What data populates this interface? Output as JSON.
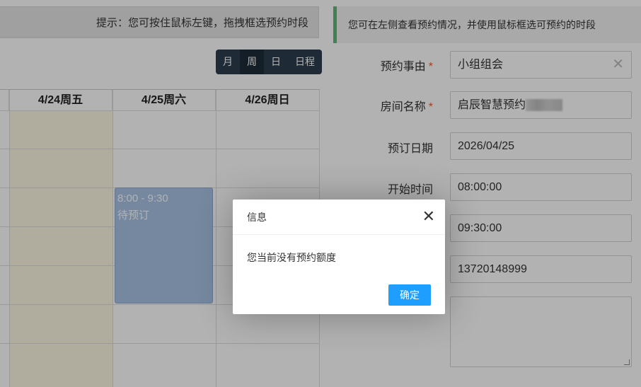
{
  "left": {
    "hint": "提示：您可按住鼠标左键，拖拽框选预约时段",
    "views": [
      {
        "label": "月",
        "active": false
      },
      {
        "label": "周",
        "active": true
      },
      {
        "label": "日",
        "active": false
      },
      {
        "label": "日程",
        "active": false
      }
    ],
    "calendar": {
      "columns": [
        "",
        "4/24周五",
        "4/25周六",
        "4/26周日"
      ],
      "event": {
        "time": "8:00 - 9:30",
        "status": "待预订"
      }
    }
  },
  "right": {
    "info": "您可在左侧查看预约情况，并使用鼠标框选可预约的时段",
    "form": {
      "reason_label": "预约事由",
      "reason_value": "小组组会",
      "room_label": "房间名称",
      "room_value": "启辰智慧预约",
      "date_label": "预订日期",
      "date_value": "2026/04/25",
      "start_label": "开始时间",
      "start_value": "08:00:00",
      "end_value": "09:30:00",
      "phone_value": "13720148999",
      "required_mark": "*"
    }
  },
  "dialog": {
    "title": "信息",
    "message": "您当前没有预约额度",
    "confirm": "确定"
  }
}
